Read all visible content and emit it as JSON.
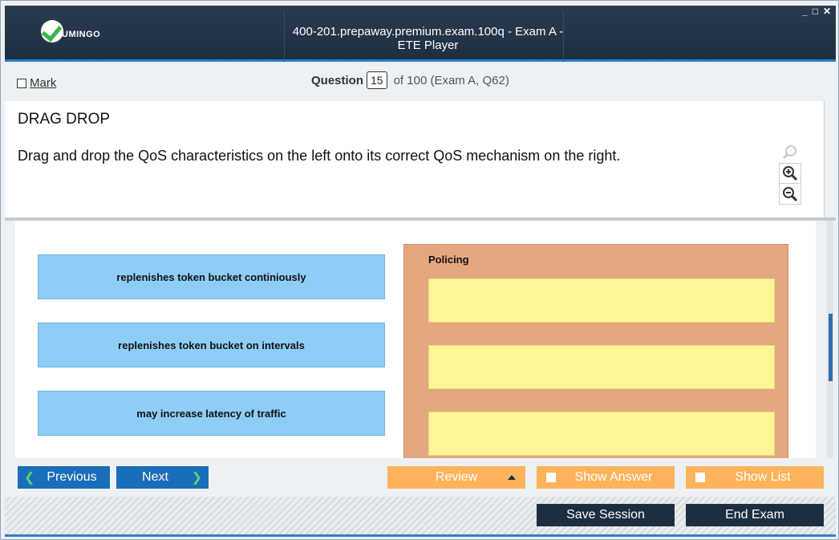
{
  "app": {
    "logo_text": "UMINGO",
    "window_title": "400-201.prepaway.premium.exam.100q - Exam A - ETE Player",
    "window_controls": [
      "_",
      "□",
      "✕"
    ]
  },
  "question_header": {
    "mark_label": "Mark",
    "question_label": "Question",
    "question_number": "15",
    "question_of": "of 100 (Exam A, Q62)"
  },
  "question": {
    "type": "DRAG DROP",
    "text": "Drag and drop the QoS characteristics on the left onto its correct QoS mechanism on the right."
  },
  "zoom": {
    "icons": [
      "magnifier-icon",
      "zoom-in-icon",
      "zoom-out-icon"
    ]
  },
  "drag_items": [
    "replenishes token bucket continiously",
    "replenishes token bucket on intervals",
    "may increase latency of traffic",
    ""
  ],
  "target_panel": {
    "heading": "Policing",
    "slots": [
      "",
      "",
      ""
    ]
  },
  "nav": {
    "previous_label": "Previous",
    "next_label": "Next",
    "review_label": "Review",
    "show_answer_label": "Show Answer",
    "show_list_label": "Show List"
  },
  "footer": {
    "save_label": "Save Session",
    "end_label": "End Exam"
  },
  "colors": {
    "title_bar": "#22334a",
    "accent_blue": "#1a6db8",
    "drag_item": "#8ecdf6",
    "target_panel": "#e5a782",
    "drop_slot": "#fdf596",
    "orange_button": "#fdb35b",
    "dark_button": "#1e2e42"
  }
}
